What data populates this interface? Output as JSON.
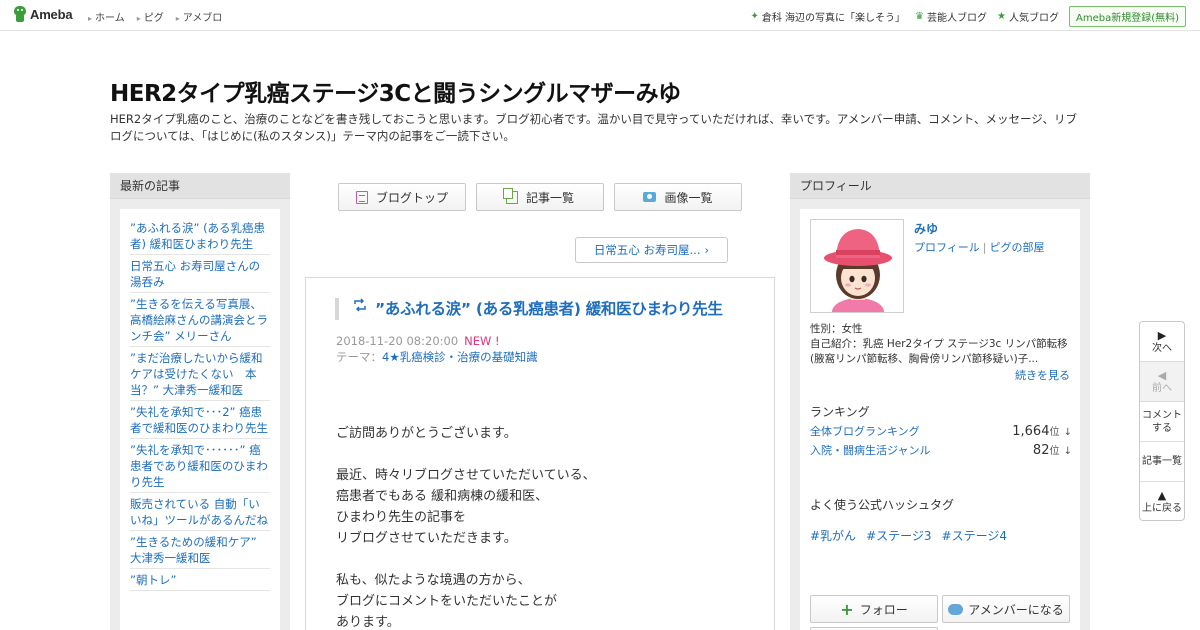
{
  "global_header": {
    "logo_text": "Ameba",
    "nav": [
      "ホーム",
      "ピグ",
      "アメブロ"
    ],
    "trend_text": "倉科 海辺の写真に「楽しそう」",
    "celebrity_blog": "芸能人ブログ",
    "popular_blog": "人気ブログ",
    "register": "Ameba新規登録(無料)"
  },
  "blog": {
    "title": "HER2タイプ乳癌ステージ3Cと闘うシングルマザーみゆ",
    "description": "HER2タイプ乳癌のこと、治療のことなどを書き残しておこうと思います。ブログ初心者です。温かい目で見守っていただければ、幸いです。アメンバー申請、コメント、メッセージ、リブログについては、「はじめに(私のスタンス)」テーマ内の記事をご一読下さい。"
  },
  "left_sidebar": {
    "heading": "最新の記事",
    "items": [
      "”あふれる涙” (ある乳癌患者) 緩和医ひまわり先生",
      "日常五心 お寿司屋さんの湯呑み",
      "”生きるを伝える写真展、高橋絵麻さんの講演会とランチ会” メリーさん",
      "”まだ治療したいから緩和ケアは受けたくない　本当？” 大津秀一緩和医",
      "”失礼を承知で･･･2” 癌患者で緩和医のひまわり先生",
      "”失礼を承知で･･････” 癌患者であり緩和医のひまわり先生",
      "販売されている 自動「いいね」ツールがあるんだね",
      "”生きるための緩和ケア” 大津秀一緩和医",
      "”朝トレ”"
    ]
  },
  "toolbar": {
    "blog_top": "ブログトップ",
    "article_list": "記事一覧",
    "image_list": "画像一覧"
  },
  "next_post": "日常五心 お寿司屋...",
  "article": {
    "title": "”あふれる涙” (ある乳癌患者) 緩和医ひまわり先生",
    "date": "2018-11-20 08:20:00",
    "new_badge": "NEW !",
    "theme_label": "テーマ：",
    "theme": "4★乳癌検診・治療の基礎知識",
    "paragraphs": [
      [
        "ご訪問ありがとうございます。"
      ],
      [
        "最近、時々リブログさせていただいている、",
        "癌患者でもある 緩和病棟の緩和医、",
        "ひまわり先生の記事を",
        "リブログさせていただきます。"
      ],
      [
        "私も、似たような境遇の方から、",
        "ブログにコメントをいただいたことが",
        "あります。"
      ]
    ]
  },
  "profile": {
    "heading": "プロフィール",
    "name": "みゆ",
    "link_profile": "プロフィール",
    "link_pig": "ピグの部屋",
    "gender": "性別：女性",
    "intro": "自己紹介：乳癌 Her2タイプ ステージ3c リンパ節転移 (腋窩リンパ節転移、胸骨傍リンパ節移疑い)子...",
    "more": "続きを見る",
    "ranking_heading": "ランキング",
    "rankings": [
      {
        "name": "全体ブログランキング",
        "value": "1,664",
        "unit": "位",
        "trend": "↓"
      },
      {
        "name": "入院・闘病生活ジャンル",
        "value": "82",
        "unit": "位",
        "trend": "↓"
      }
    ],
    "hashtag_heading": "よく使う公式ハッシュタグ",
    "hashtags": [
      "#乳がん",
      "#ステージ3",
      "#ステージ4"
    ],
    "follow": "フォロー",
    "member": "アメンバーになる"
  },
  "pager": {
    "next": "次へ",
    "prev": "前へ",
    "comment_line1": "コメント",
    "comment_line2": "する",
    "list": "記事一覧",
    "top": "上に戻る"
  }
}
